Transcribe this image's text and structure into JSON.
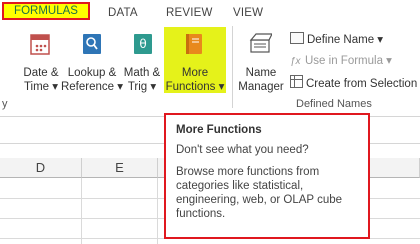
{
  "tabs": {
    "active": "FORMULAS",
    "items": [
      "DATA",
      "REVIEW",
      "VIEW"
    ]
  },
  "ribbon": {
    "date_time": [
      "Date &",
      "Time ▾"
    ],
    "lookup_reference": [
      "Lookup &",
      "Reference ▾"
    ],
    "math_trig": [
      "Math &",
      "Trig ▾"
    ],
    "more_functions": [
      "More",
      "Functions ▾"
    ],
    "name_manager": [
      "Name",
      "Manager"
    ],
    "define_name": "Define Name ▾",
    "use_in_formula": "Use in Formula ▾",
    "create_from_selection": "Create from Selection",
    "group_label_defined_names": "Defined Names",
    "group_label_left": "y"
  },
  "grid": {
    "columns": [
      "D",
      "E"
    ]
  },
  "tooltip": {
    "title": "More Functions",
    "question": "Don't see what you need?",
    "description": "Browse more functions from categories like statistical, engineering, web, or OLAP cube functions."
  },
  "colors": {
    "highlight_yellow": "#e5f21a",
    "tab_yellow": "#ffff00",
    "annotation_red": "#e0181f",
    "excel_green": "#1e7145"
  }
}
